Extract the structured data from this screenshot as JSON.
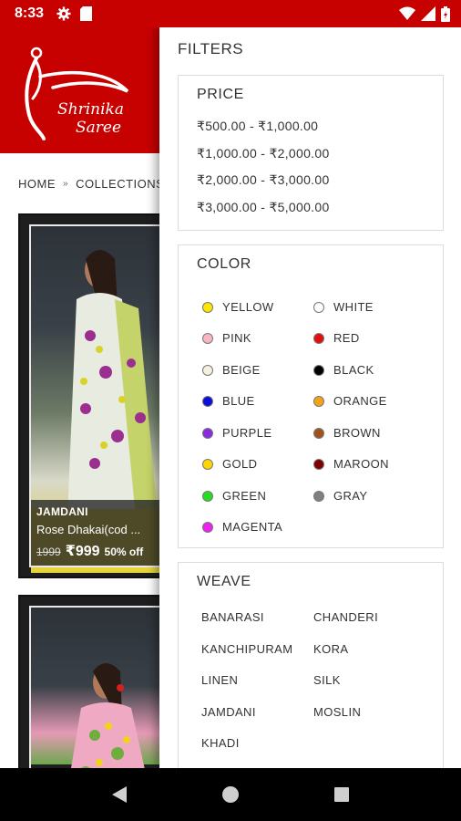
{
  "status_bar": {
    "time": "8:33",
    "left_icons": [
      "gear-icon",
      "sd-card-icon"
    ],
    "right_icons": [
      "wifi-icon",
      "signal-icon",
      "battery-icon"
    ]
  },
  "header": {
    "logo_line1": "Shrinika",
    "logo_line2": "Saree",
    "brand_color": "#c70000"
  },
  "breadcrumb": [
    "HOME",
    "COLLECTIONS"
  ],
  "products": [
    {
      "category": "JAMDANI",
      "name": "Rose Dhakai(cod ...",
      "old_price": "1999",
      "new_price": "₹999",
      "discount": "50% off"
    }
  ],
  "filters": {
    "title": "FILTERS",
    "price": {
      "title": "PRICE",
      "options": [
        "₹500.00 - ₹1,000.00",
        "₹1,000.00 - ₹2,000.00",
        "₹2,000.00 - ₹3,000.00",
        "₹3,000.00 - ₹5,000.00"
      ]
    },
    "color": {
      "title": "COLOR",
      "options": [
        {
          "label": "YELLOW",
          "color": "#ffe600"
        },
        {
          "label": "WHITE",
          "color": "#ffffff"
        },
        {
          "label": "PINK",
          "color": "#f7b6c2"
        },
        {
          "label": "RED",
          "color": "#e01010"
        },
        {
          "label": "BEIGE",
          "color": "#f5f0dc"
        },
        {
          "label": "BLACK",
          "color": "#000000"
        },
        {
          "label": "BLUE",
          "color": "#0a10d8"
        },
        {
          "label": "ORANGE",
          "color": "#f5a21a"
        },
        {
          "label": "PURPLE",
          "color": "#8a2be2"
        },
        {
          "label": "BROWN",
          "color": "#a0521d"
        },
        {
          "label": "GOLD",
          "color": "#ffd500"
        },
        {
          "label": "MAROON",
          "color": "#800000"
        },
        {
          "label": "GREEN",
          "color": "#22dd22"
        },
        {
          "label": "GRAY",
          "color": "#808080"
        },
        {
          "label": "MAGENTA",
          "color": "#ee22ee"
        }
      ]
    },
    "weave": {
      "title": "WEAVE",
      "options": [
        "BANARASI",
        "CHANDERI",
        "KANCHIPURAM",
        "KORA",
        "LINEN",
        "SILK",
        "JAMDANI",
        "MOSLIN",
        "KHADI"
      ]
    }
  },
  "nav_bar": {
    "buttons": [
      "back-icon",
      "home-icon",
      "recents-icon"
    ]
  }
}
